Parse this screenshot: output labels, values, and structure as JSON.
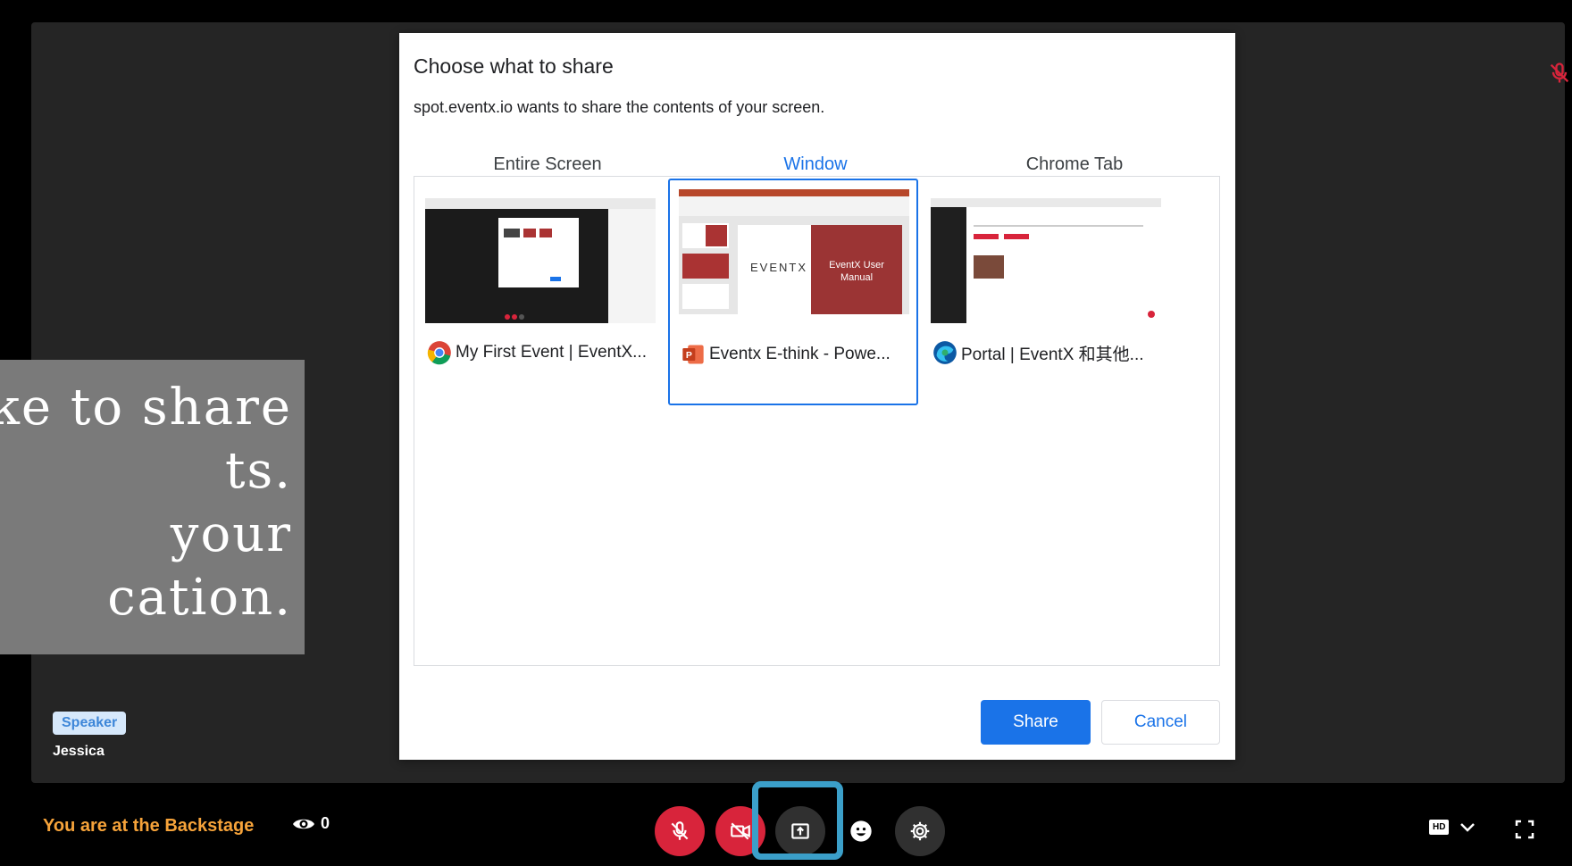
{
  "overlay_caption": {
    "lines": [
      "ke to share",
      "ts.",
      " your",
      "cation."
    ]
  },
  "speaker": {
    "badge": "Speaker",
    "name": "Jessica"
  },
  "dialog": {
    "title": "Choose what to share",
    "subtitle": "spot.eventx.io wants to share the contents of your screen.",
    "tabs": [
      {
        "label": "Entire Screen",
        "active": false
      },
      {
        "label": "Window",
        "active": true
      },
      {
        "label": "Chrome Tab",
        "active": false
      }
    ],
    "windows": [
      {
        "label": "My First Event | EventX...",
        "icon": "chrome-icon",
        "selected": false
      },
      {
        "label": "Eventx E-think - Powe...",
        "icon": "powerpoint-icon",
        "selected": true,
        "thumb_text": "EventX User Manual",
        "logo": "EVENTX"
      },
      {
        "label": "Portal | EventX 和其他...",
        "icon": "edge-icon",
        "selected": false
      }
    ],
    "share_label": "Share",
    "cancel_label": "Cancel"
  },
  "bottom_bar": {
    "status": "You are at the Backstage",
    "viewer_count": "0",
    "hd_label": "HD"
  },
  "colors": {
    "accent": "#1a73e8",
    "danger": "#d8243b",
    "backstage": "#f6a33a",
    "highlight": "#3b9fc9"
  }
}
